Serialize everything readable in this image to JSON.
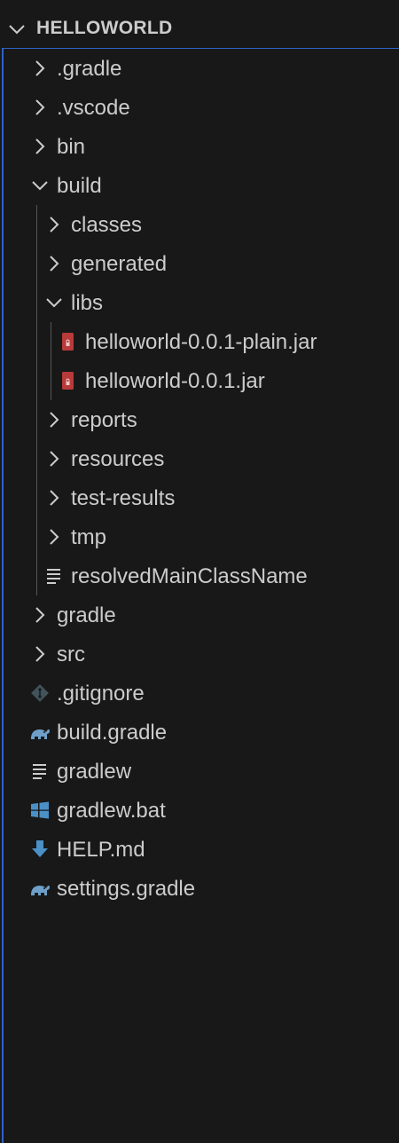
{
  "explorer": {
    "section_title": "HELLOWORLD",
    "items": [
      {
        "label": ".gradle",
        "kind": "folder",
        "expanded": false,
        "depth": 0,
        "icon": "chevron-right-icon"
      },
      {
        "label": ".vscode",
        "kind": "folder",
        "expanded": false,
        "depth": 0,
        "icon": "chevron-right-icon"
      },
      {
        "label": "bin",
        "kind": "folder",
        "expanded": false,
        "depth": 0,
        "icon": "chevron-right-icon"
      },
      {
        "label": "build",
        "kind": "folder",
        "expanded": true,
        "depth": 0,
        "icon": "chevron-down-icon"
      },
      {
        "label": "classes",
        "kind": "folder",
        "expanded": false,
        "depth": 1,
        "icon": "chevron-right-icon"
      },
      {
        "label": "generated",
        "kind": "folder",
        "expanded": false,
        "depth": 1,
        "icon": "chevron-right-icon"
      },
      {
        "label": "libs",
        "kind": "folder",
        "expanded": true,
        "depth": 1,
        "icon": "chevron-down-icon"
      },
      {
        "label": "helloworld-0.0.1-plain.jar",
        "kind": "file",
        "depth": 2,
        "icon": "jar-file-icon"
      },
      {
        "label": "helloworld-0.0.1.jar",
        "kind": "file",
        "depth": 2,
        "icon": "jar-file-icon"
      },
      {
        "label": "reports",
        "kind": "folder",
        "expanded": false,
        "depth": 1,
        "icon": "chevron-right-icon"
      },
      {
        "label": "resources",
        "kind": "folder",
        "expanded": false,
        "depth": 1,
        "icon": "chevron-right-icon"
      },
      {
        "label": "test-results",
        "kind": "folder",
        "expanded": false,
        "depth": 1,
        "icon": "chevron-right-icon"
      },
      {
        "label": "tmp",
        "kind": "folder",
        "expanded": false,
        "depth": 1,
        "icon": "chevron-right-icon"
      },
      {
        "label": "resolvedMainClassName",
        "kind": "file",
        "depth": 1,
        "icon": "text-lines-icon"
      },
      {
        "label": "gradle",
        "kind": "folder",
        "expanded": false,
        "depth": 0,
        "icon": "chevron-right-icon"
      },
      {
        "label": "src",
        "kind": "folder",
        "expanded": false,
        "depth": 0,
        "icon": "chevron-right-icon"
      },
      {
        "label": ".gitignore",
        "kind": "file",
        "depth": 0,
        "icon": "git-icon"
      },
      {
        "label": "build.gradle",
        "kind": "file",
        "depth": 0,
        "icon": "gradle-elephant-icon"
      },
      {
        "label": "gradlew",
        "kind": "file",
        "depth": 0,
        "icon": "text-lines-icon"
      },
      {
        "label": "gradlew.bat",
        "kind": "file",
        "depth": 0,
        "icon": "windows-icon"
      },
      {
        "label": "HELP.md",
        "kind": "file",
        "depth": 0,
        "icon": "download-arrow-icon"
      },
      {
        "label": "settings.gradle",
        "kind": "file",
        "depth": 0,
        "icon": "gradle-elephant-icon"
      }
    ]
  },
  "colors": {
    "background": "#181818",
    "text": "#cccccc",
    "focus_border": "#2e63c9",
    "jar_icon": "#b83a3a",
    "gradle_icon": "#6e9fc9",
    "git_icon": "#41535b",
    "windows_icon": "#4a90c7",
    "markdown_icon": "#4a90c7"
  }
}
